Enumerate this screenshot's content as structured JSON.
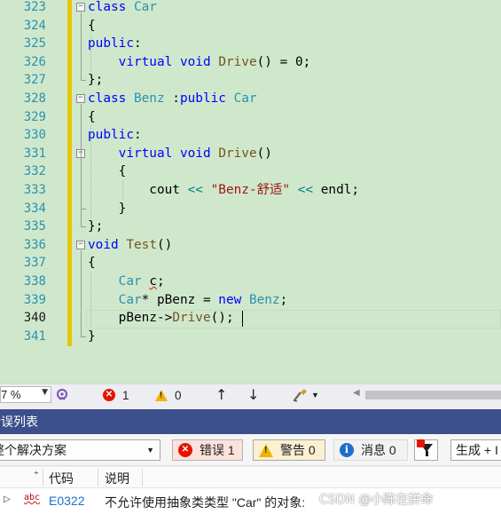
{
  "editor": {
    "line_numbers": [
      "323",
      "324",
      "325",
      "326",
      "327",
      "328",
      "329",
      "330",
      "331",
      "332",
      "333",
      "334",
      "335",
      "336",
      "337",
      "338",
      "339",
      "340",
      "341"
    ],
    "current_line": "340",
    "code_lines": [
      [
        {
          "t": "class ",
          "c": "kw"
        },
        {
          "t": "Car",
          "c": "ty"
        }
      ],
      [
        {
          "t": "{",
          "c": ""
        }
      ],
      [
        {
          "t": "public",
          "c": "kw"
        },
        {
          "t": ":",
          "c": ""
        }
      ],
      [
        {
          "t": "    ",
          "c": ""
        },
        {
          "t": "virtual",
          "c": "kw"
        },
        {
          "t": " ",
          "c": ""
        },
        {
          "t": "void",
          "c": "kw"
        },
        {
          "t": " ",
          "c": ""
        },
        {
          "t": "Drive",
          "c": "fn"
        },
        {
          "t": "() = 0;",
          "c": ""
        }
      ],
      [
        {
          "t": "};",
          "c": ""
        }
      ],
      [
        {
          "t": "class ",
          "c": "kw"
        },
        {
          "t": "Benz",
          "c": "ty"
        },
        {
          "t": " :",
          "c": ""
        },
        {
          "t": "public",
          "c": "kw"
        },
        {
          "t": " ",
          "c": ""
        },
        {
          "t": "Car",
          "c": "ty"
        }
      ],
      [
        {
          "t": "{",
          "c": ""
        }
      ],
      [
        {
          "t": "public",
          "c": "kw"
        },
        {
          "t": ":",
          "c": ""
        }
      ],
      [
        {
          "t": "    ",
          "c": ""
        },
        {
          "t": "virtual",
          "c": "kw"
        },
        {
          "t": " ",
          "c": ""
        },
        {
          "t": "void",
          "c": "kw"
        },
        {
          "t": " ",
          "c": ""
        },
        {
          "t": "Drive",
          "c": "fn"
        },
        {
          "t": "()",
          "c": ""
        }
      ],
      [
        {
          "t": "    {",
          "c": ""
        }
      ],
      [
        {
          "t": "        cout ",
          "c": ""
        },
        {
          "t": "<<",
          "c": "op"
        },
        {
          "t": " ",
          "c": ""
        },
        {
          "t": "\"Benz-舒适\"",
          "c": "str"
        },
        {
          "t": " ",
          "c": ""
        },
        {
          "t": "<<",
          "c": "op"
        },
        {
          "t": " endl;",
          "c": ""
        }
      ],
      [
        {
          "t": "    }",
          "c": ""
        }
      ],
      [
        {
          "t": "};",
          "c": ""
        }
      ],
      [
        {
          "t": "void",
          "c": "kw"
        },
        {
          "t": " ",
          "c": ""
        },
        {
          "t": "Test",
          "c": "fn"
        },
        {
          "t": "()",
          "c": ""
        }
      ],
      [
        {
          "t": "{",
          "c": ""
        }
      ],
      [
        {
          "t": "    ",
          "c": ""
        },
        {
          "t": "Car",
          "c": "ty"
        },
        {
          "t": " ",
          "c": ""
        },
        {
          "t": "c",
          "c": "squiggle"
        },
        {
          "t": ";",
          "c": ""
        }
      ],
      [
        {
          "t": "    ",
          "c": ""
        },
        {
          "t": "Car",
          "c": "ty"
        },
        {
          "t": "* pBenz = ",
          "c": ""
        },
        {
          "t": "new",
          "c": "kw"
        },
        {
          "t": " ",
          "c": ""
        },
        {
          "t": "Benz",
          "c": "ty"
        },
        {
          "t": ";",
          "c": ""
        }
      ],
      [
        {
          "t": "    pBenz->",
          "c": ""
        },
        {
          "t": "Drive",
          "c": "fn"
        },
        {
          "t": "();",
          "c": ""
        }
      ],
      [
        {
          "t": "}",
          "c": ""
        }
      ]
    ]
  },
  "status_strip": {
    "zoom": "7 %",
    "error_count": "1",
    "warning_count": "0",
    "up_arrow": "↑",
    "down_arrow": "↓"
  },
  "error_list": {
    "title": "错误列表",
    "scope": "整个解决方案",
    "errors_label": "错误 1",
    "warnings_label": "警告 0",
    "messages_label": "消息 0",
    "build_label": "生成 + I",
    "columns": {
      "code": "代码",
      "description": "说明"
    },
    "rows": [
      {
        "code": "E0322",
        "description": "不允许使用抽象类类型 \"Car\" 的对象:"
      }
    ]
  },
  "watermark": "CSDN @​​小陈在拼命​​"
}
